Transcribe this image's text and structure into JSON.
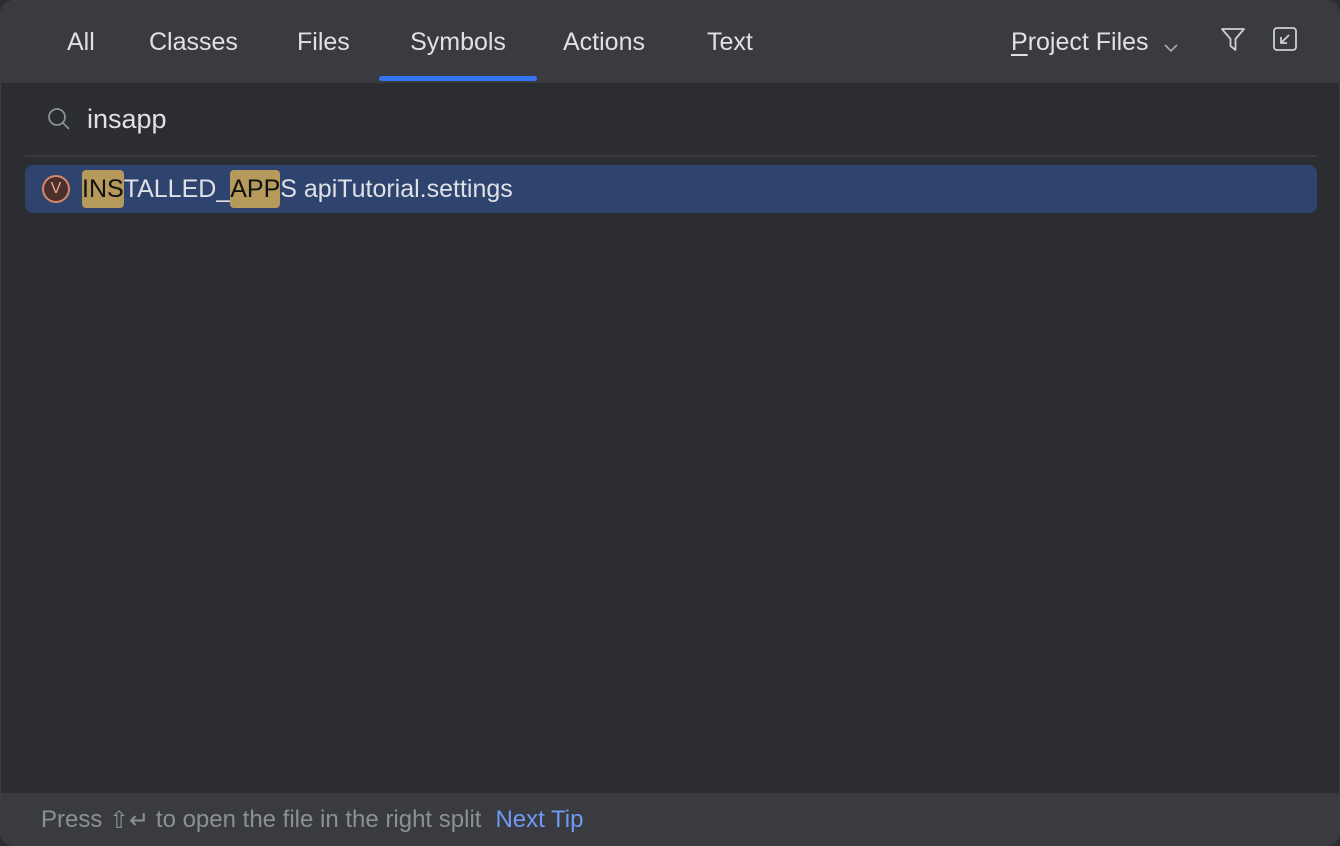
{
  "tabs": [
    {
      "label": "All",
      "active": false
    },
    {
      "label": "Classes",
      "active": false
    },
    {
      "label": "Files",
      "active": false
    },
    {
      "label": "Symbols",
      "active": true
    },
    {
      "label": "Actions",
      "active": false
    },
    {
      "label": "Text",
      "active": false
    }
  ],
  "scope": {
    "mnemonic": "P",
    "rest": "roject Files",
    "dropdown_icon": "chevron-down-icon"
  },
  "toolbar": {
    "filter_icon": "filter-icon",
    "open_in_window_icon": "open-in-tool-window-icon"
  },
  "search": {
    "icon": "search-icon",
    "value": "insapp",
    "placeholder": ""
  },
  "results": [
    {
      "icon": "variable-icon",
      "icon_letter": "V",
      "segments": [
        {
          "text": "INS",
          "match": true
        },
        {
          "text": "TALLED_",
          "match": false
        },
        {
          "text": "APP",
          "match": true
        },
        {
          "text": "S",
          "match": false
        }
      ],
      "location": " apiTutorial.settings",
      "selected": true
    }
  ],
  "footer": {
    "tip_prefix": "Press ",
    "shortcut": "⇧↵",
    "tip_suffix": " to open the file in the right split",
    "next_tip_label": "Next Tip"
  },
  "colors": {
    "accent": "#3574f0",
    "selection": "#2e436e",
    "match_highlight": "#b59a5c",
    "link": "#6f9bf2"
  }
}
